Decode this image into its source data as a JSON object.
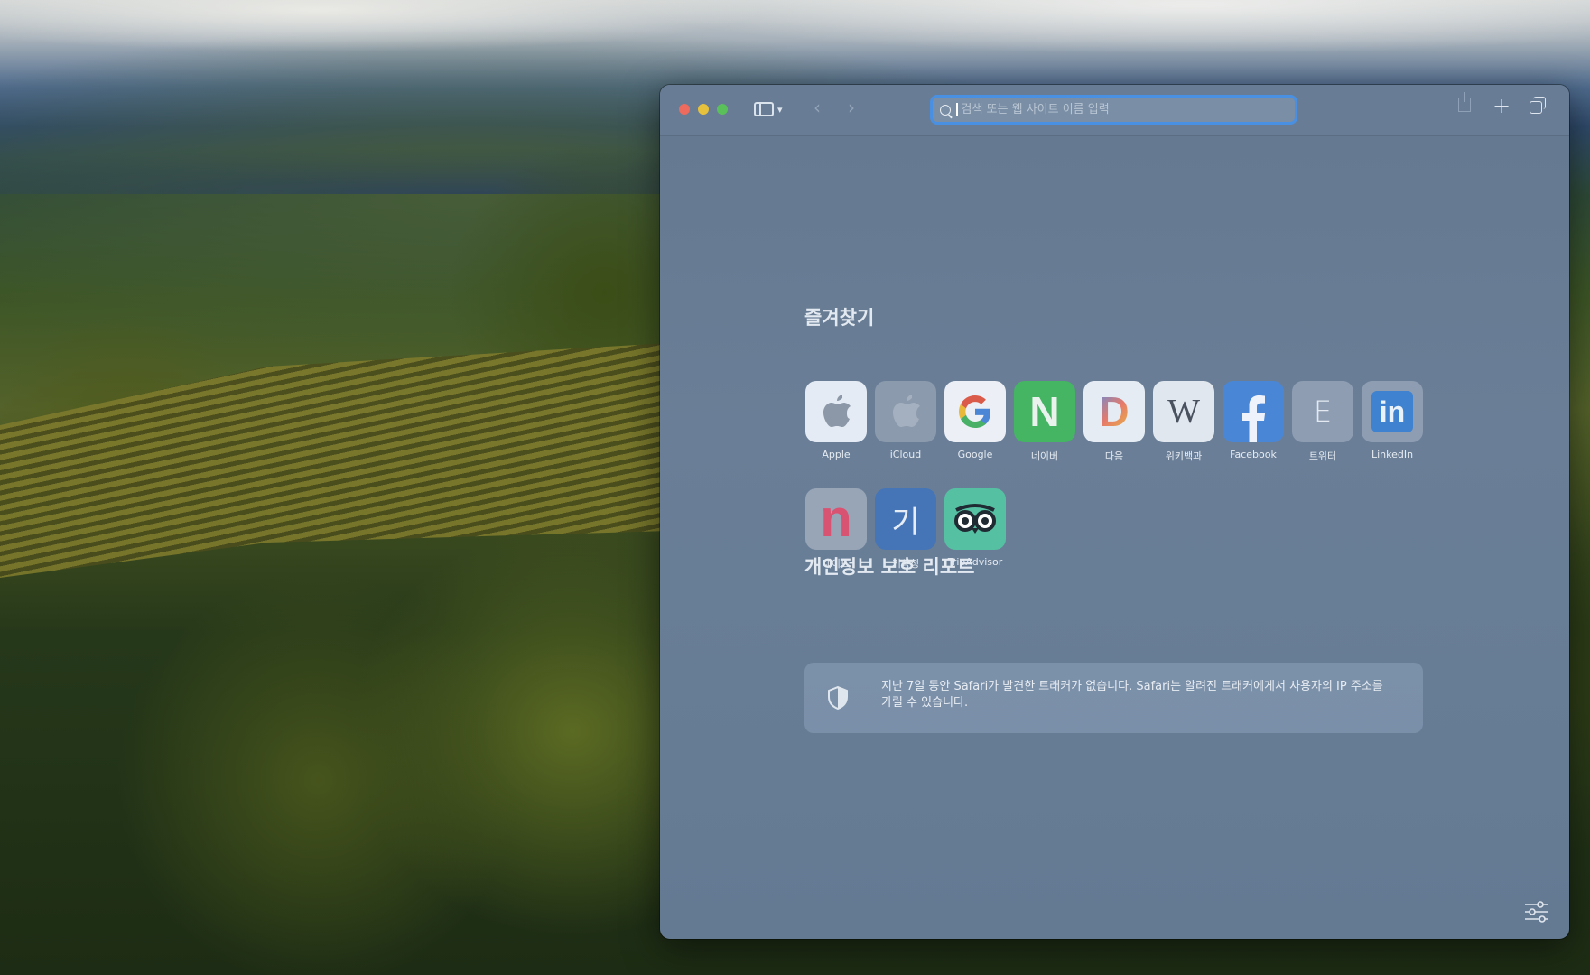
{
  "browser": {
    "address_placeholder": "검색 또는 웹 사이트 이름 입력"
  },
  "favorites": {
    "title": "즐겨찾기",
    "items": [
      {
        "label": "Apple",
        "icon": "apple-icon",
        "color": "#e6edf6"
      },
      {
        "label": "iCloud",
        "icon": "apple-icon",
        "color": "#8f9db0"
      },
      {
        "label": "Google",
        "icon": "google-icon",
        "color": "#eef2f7"
      },
      {
        "label": "네이버",
        "icon": "naver-icon",
        "color": "#47b665"
      },
      {
        "label": "다음",
        "icon": "daum-icon",
        "color": "#e8eef6"
      },
      {
        "label": "위키백과",
        "icon": "wikipedia-icon",
        "color": "#e2e8f0"
      },
      {
        "label": "Facebook",
        "icon": "facebook-icon",
        "color": "#4b86d6"
      },
      {
        "label": "트위터",
        "icon": "letter-icon",
        "color": "#8e9db1"
      },
      {
        "label": "LinkedIn",
        "icon": "linkedin-icon",
        "color": "#8e9db1"
      },
      {
        "label": "네이트",
        "icon": "nate-icon",
        "color": "#9aa7b8"
      },
      {
        "label": "기상청",
        "icon": "letter-icon",
        "color": "#4677b8"
      },
      {
        "label": "TripAdvisor",
        "icon": "tripadvisor-icon",
        "color": "#57c1a3"
      }
    ],
    "tile_glyphs": {
      "naver": "N",
      "daum": "D",
      "wikipedia": "W",
      "twitter": "E",
      "linkedin": "in",
      "nate": "n",
      "kma": "기"
    }
  },
  "privacy_report": {
    "title": "개인정보 보호 리포트",
    "message": "지난 7일 동안 Safari가 발견한 트래커가 없습니다. Safari는 알려진 트래커에게서 사용자의 IP 주소를 가릴 수 있습니다."
  }
}
